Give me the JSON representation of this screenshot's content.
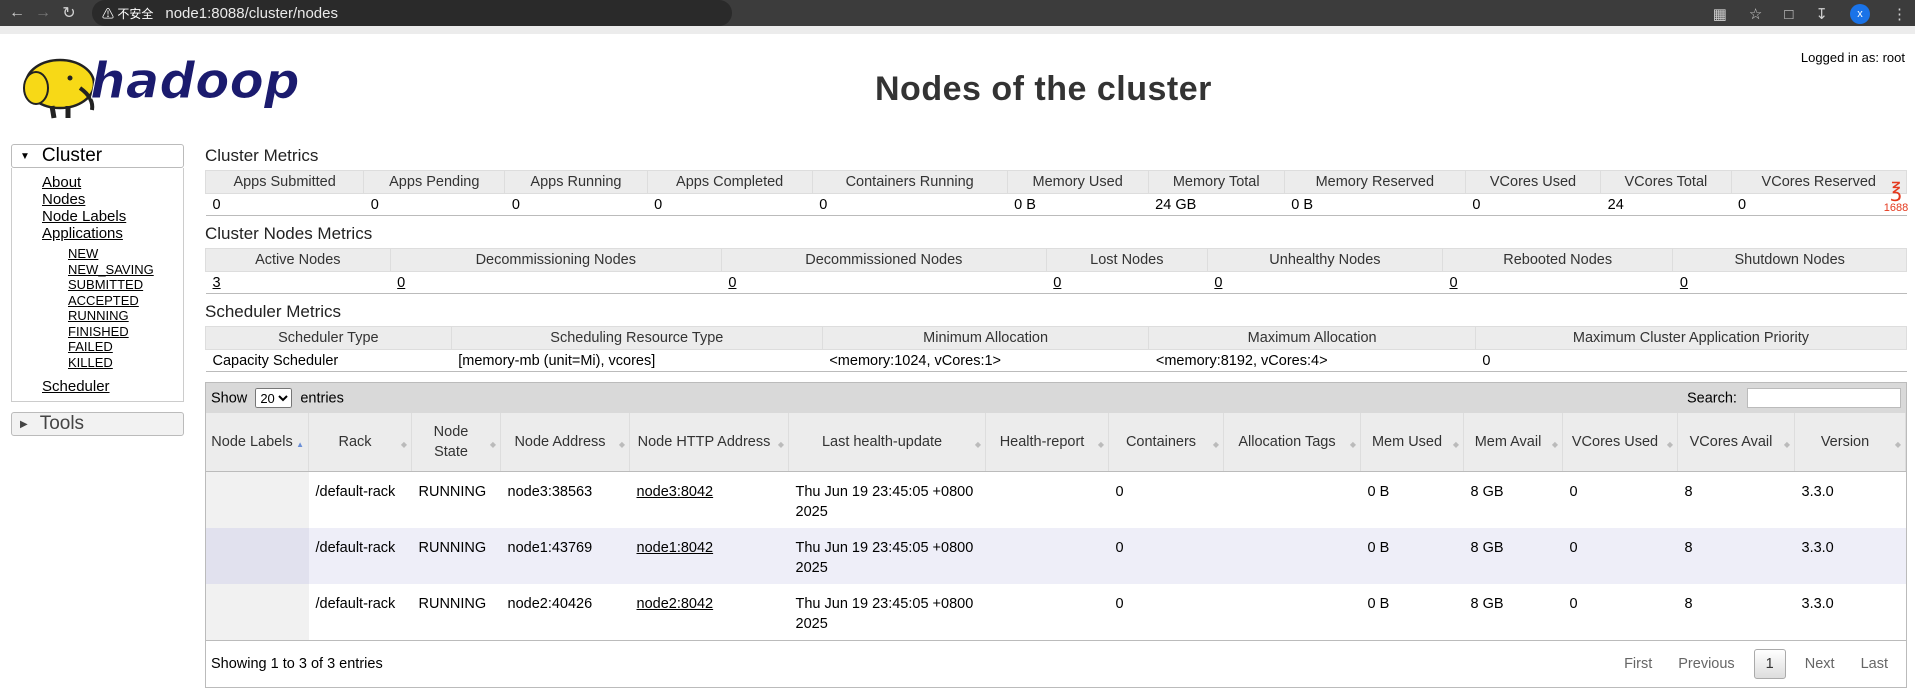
{
  "browser": {
    "security_label": "不安全",
    "url": "node1:8088/cluster/nodes",
    "profile_initial": "x"
  },
  "header": {
    "logo_text": "hadoop",
    "title": "Nodes of the cluster",
    "login": "Logged in as: root"
  },
  "sidebar": {
    "cluster_label": "Cluster",
    "links": [
      "About",
      "Nodes",
      "Node Labels",
      "Applications"
    ],
    "app_states": [
      "NEW",
      "NEW_SAVING",
      "SUBMITTED",
      "ACCEPTED",
      "RUNNING",
      "FINISHED",
      "FAILED",
      "KILLED"
    ],
    "scheduler": "Scheduler",
    "tools_label": "Tools"
  },
  "cluster_metrics": {
    "title": "Cluster Metrics",
    "headers": [
      "Apps Submitted",
      "Apps Pending",
      "Apps Running",
      "Apps Completed",
      "Containers Running",
      "Memory Used",
      "Memory Total",
      "Memory Reserved",
      "VCores Used",
      "VCores Total",
      "VCores Reserved"
    ],
    "values": [
      "0",
      "0",
      "0",
      "0",
      "0",
      "0 B",
      "24 GB",
      "0 B",
      "0",
      "24",
      "0"
    ]
  },
  "nodes_metrics": {
    "title": "Cluster Nodes Metrics",
    "headers": [
      "Active Nodes",
      "Decommissioning Nodes",
      "Decommissioned Nodes",
      "Lost Nodes",
      "Unhealthy Nodes",
      "Rebooted Nodes",
      "Shutdown Nodes"
    ],
    "values": [
      "3",
      "0",
      "0",
      "0",
      "0",
      "0",
      "0"
    ]
  },
  "scheduler_metrics": {
    "title": "Scheduler Metrics",
    "headers": [
      "Scheduler Type",
      "Scheduling Resource Type",
      "Minimum Allocation",
      "Maximum Allocation",
      "Maximum Cluster Application Priority"
    ],
    "values": [
      "Capacity Scheduler",
      "[memory-mb (unit=Mi), vcores]",
      "<memory:1024, vCores:1>",
      "<memory:8192, vCores:4>",
      "0"
    ]
  },
  "nodes_table": {
    "show_label": "Show",
    "page_size": "20",
    "entries_label": "entries",
    "search_label": "Search:",
    "headers": [
      "Node Labels",
      "Rack",
      "Node State",
      "Node Address",
      "Node HTTP Address",
      "Last health-update",
      "Health-report",
      "Containers",
      "Allocation Tags",
      "Mem Used",
      "Mem Avail",
      "VCores Used",
      "VCores Avail",
      "Version"
    ],
    "rows": [
      [
        "",
        "/default-rack",
        "RUNNING",
        "node3:38563",
        "node3:8042",
        "Thu Jun 19 23:45:05 +0800 2025",
        "",
        "0",
        "",
        "0 B",
        "8 GB",
        "0",
        "8",
        "3.3.0"
      ],
      [
        "",
        "/default-rack",
        "RUNNING",
        "node1:43769",
        "node1:8042",
        "Thu Jun 19 23:45:05 +0800 2025",
        "",
        "0",
        "",
        "0 B",
        "8 GB",
        "0",
        "8",
        "3.3.0"
      ],
      [
        "",
        "/default-rack",
        "RUNNING",
        "node2:40426",
        "node2:8042",
        "Thu Jun 19 23:45:05 +0800 2025",
        "",
        "0",
        "",
        "0 B",
        "8 GB",
        "0",
        "8",
        "3.3.0"
      ]
    ],
    "info": "Showing 1 to 3 of 3 entries",
    "pager": {
      "first": "First",
      "previous": "Previous",
      "current": "1",
      "next": "Next",
      "last": "Last"
    }
  },
  "extension_badge": "1688"
}
